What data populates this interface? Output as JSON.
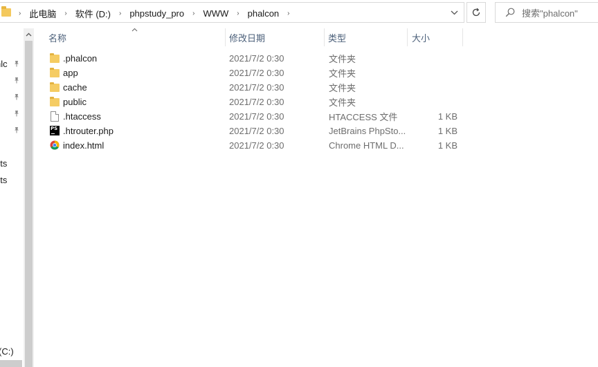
{
  "address": {
    "crumbs": [
      "此电脑",
      "软件 (D:)",
      "phpstudy_pro",
      "WWW",
      "phalcon"
    ],
    "separator": "›",
    "dropdown_icon": "chevron-down-icon",
    "refresh_icon": "refresh-icon"
  },
  "search": {
    "placeholder": "搜索\"phalcon\""
  },
  "nav": {
    "items": [
      {
        "label": "nlc",
        "pinned": true
      },
      {
        "label": "",
        "pinned": true
      },
      {
        "label": "",
        "pinned": true
      },
      {
        "label": "",
        "pinned": true
      },
      {
        "label": "",
        "pinned": true
      },
      {
        "label": "nts",
        "pinned": false
      },
      {
        "label": "nts",
        "pinned": false
      },
      {
        "label": "(C:)",
        "pinned": false
      }
    ]
  },
  "columns": {
    "name": "名称",
    "date": "修改日期",
    "type": "类型",
    "size": "大小"
  },
  "files": [
    {
      "name": ".phalcon",
      "date": "2021/7/2 0:30",
      "type": "文件夹",
      "size": "",
      "icon": "folder-icon"
    },
    {
      "name": "app",
      "date": "2021/7/2 0:30",
      "type": "文件夹",
      "size": "",
      "icon": "folder-icon"
    },
    {
      "name": "cache",
      "date": "2021/7/2 0:30",
      "type": "文件夹",
      "size": "",
      "icon": "folder-icon"
    },
    {
      "name": "public",
      "date": "2021/7/2 0:30",
      "type": "文件夹",
      "size": "",
      "icon": "folder-icon"
    },
    {
      "name": ".htaccess",
      "date": "2021/7/2 0:30",
      "type": "HTACCESS 文件",
      "size": "1 KB",
      "icon": "file-icon"
    },
    {
      "name": ".htrouter.php",
      "date": "2021/7/2 0:30",
      "type": "JetBrains PhpSto...",
      "size": "1 KB",
      "icon": "phpstorm-icon"
    },
    {
      "name": "index.html",
      "date": "2021/7/2 0:30",
      "type": "Chrome HTML D...",
      "size": "1 KB",
      "icon": "chrome-icon"
    }
  ],
  "colors": {
    "header_text": "#4c607a",
    "folder": "#f5cc63",
    "border": "#d9d9d9",
    "muted_text": "#6d6d6d"
  }
}
